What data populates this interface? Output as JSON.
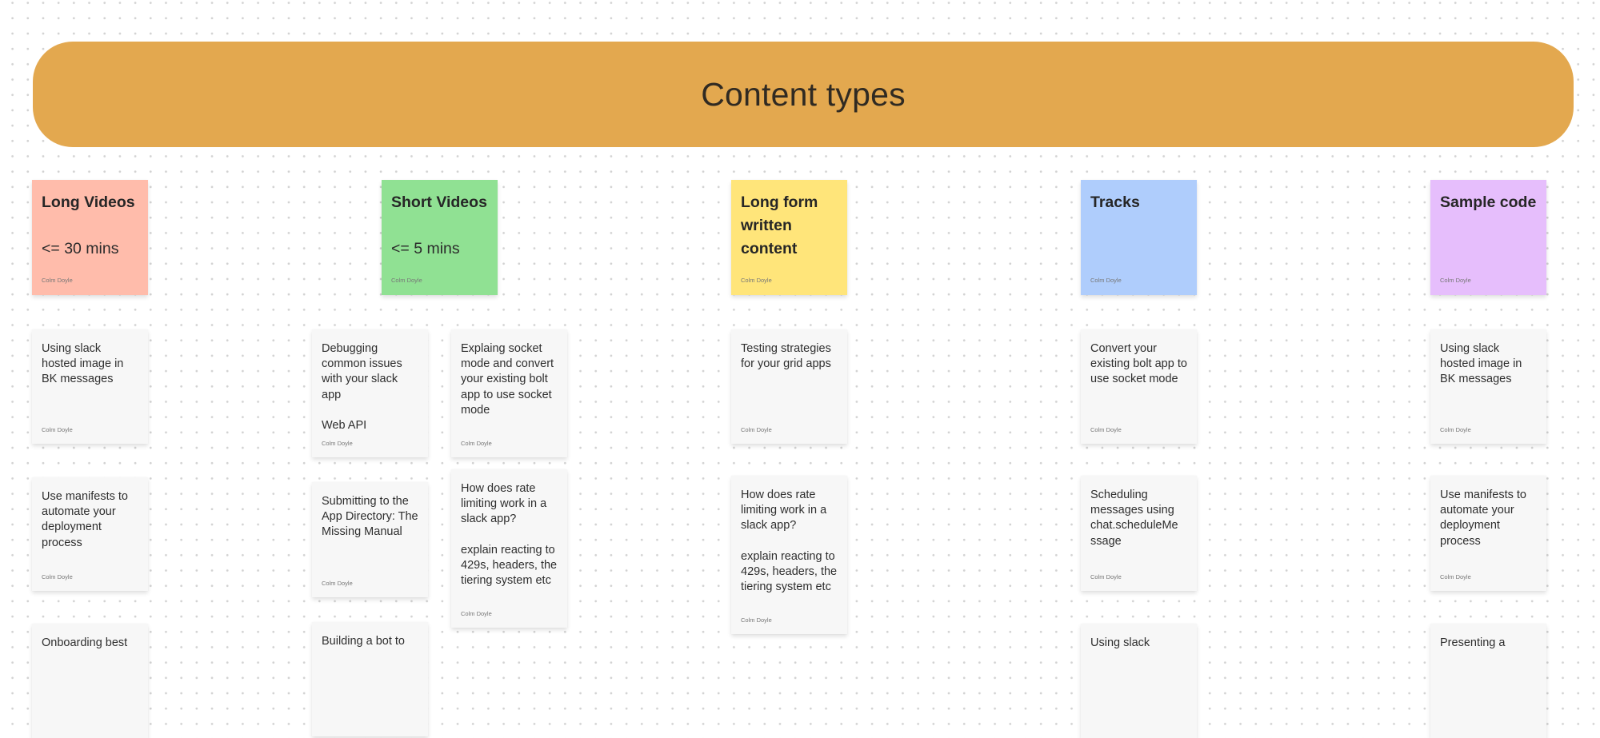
{
  "board": {
    "title": "Content types",
    "banner_color": "#e3a84f"
  },
  "columns": [
    {
      "title": "Long Videos",
      "subtitle": "<= 30 mins",
      "author": "Colm Doyle",
      "color": "#ffbcab",
      "cards": [
        {
          "text": "Using slack hosted image in BK messages",
          "author": "Colm Doyle"
        },
        {
          "text": "Use manifests to automate your deployment process",
          "author": "Colm Doyle"
        },
        {
          "text": "Onboarding best",
          "author": ""
        }
      ]
    },
    {
      "title": "Short Videos",
      "subtitle": "<= 5 mins",
      "author": "Colm Doyle",
      "color": "#90e193",
      "cards": [
        {
          "text": "Debugging common issues with your slack app\n\nWeb API",
          "author": "Colm Doyle"
        },
        {
          "text": "Submitting to the App Directory: The Missing Manual",
          "author": "Colm Doyle"
        },
        {
          "text": "Building a bot to",
          "author": ""
        },
        {
          "text": "Explaing socket mode and convert your existing bolt app to use socket mode",
          "author": "Colm Doyle"
        },
        {
          "text": "How does rate limiting work in a slack app?\n\nexplain reacting to 429s, headers, the tiering system etc",
          "author": "Colm Doyle"
        }
      ]
    },
    {
      "title": "Long form written content",
      "subtitle": "",
      "author": "Colm Doyle",
      "color": "#ffe57a",
      "cards": [
        {
          "text": "Testing strategies for your grid apps",
          "author": "Colm Doyle"
        },
        {
          "text": "How does rate limiting work in a slack app?\n\nexplain reacting to 429s, headers, the tiering system etc",
          "author": "Colm Doyle"
        }
      ]
    },
    {
      "title": "Tracks",
      "subtitle": "",
      "author": "Colm Doyle",
      "color": "#afcdfc",
      "cards": [
        {
          "text": "Convert your existing bolt app to use socket mode",
          "author": "Colm Doyle"
        },
        {
          "text": "Scheduling messages using chat.scheduleMe ssage",
          "author": "Colm Doyle"
        },
        {
          "text": "Using slack",
          "author": ""
        }
      ]
    },
    {
      "title": "Sample code",
      "subtitle": "",
      "author": "Colm Doyle",
      "color": "#e6befc",
      "cards": [
        {
          "text": "Using slack hosted image in BK messages",
          "author": "Colm Doyle"
        },
        {
          "text": "Use manifests to automate your deployment process",
          "author": "Colm Doyle"
        },
        {
          "text": "Presenting a",
          "author": ""
        }
      ]
    }
  ]
}
